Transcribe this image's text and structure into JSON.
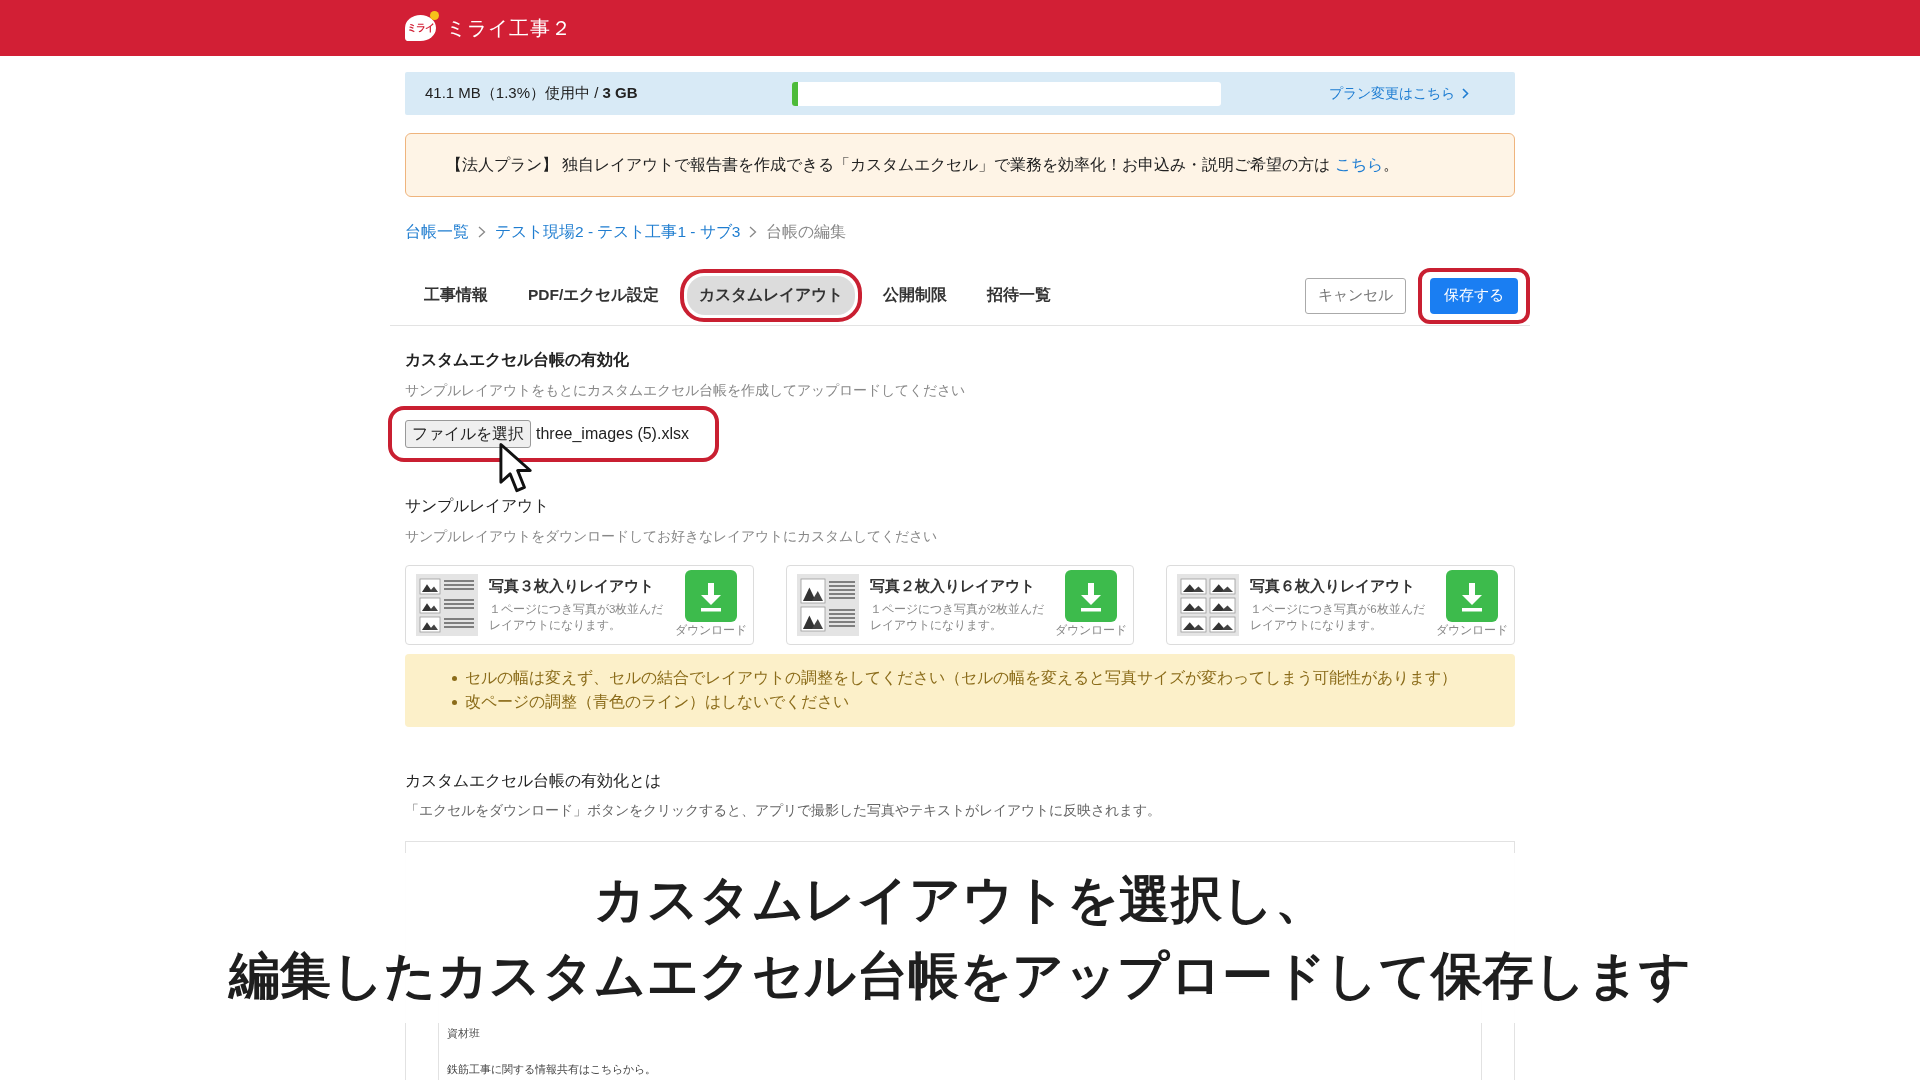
{
  "header": {
    "logo_text": "ミライ",
    "title": "ミライ工事２"
  },
  "storage": {
    "usage": "41.1 MB（1.3%）使用中 / **3 GB**",
    "level": 0.013,
    "link": "プラン変更はこちら"
  },
  "notice": {
    "text": "【法人プラン】 独自レイアウトで報告書を作成できる「カスタムエクセル」で業務を効率化！お申込み・説明ご希望の方は",
    "link": "こちら",
    "suffix": "。"
  },
  "breadcrumb": [
    {
      "label": "台帳一覧",
      "kind": "link"
    },
    {
      "label": "テスト現場2 - テスト工事1 - サブ3",
      "kind": "link"
    },
    {
      "label": "台帳の編集",
      "kind": "current"
    }
  ],
  "tabs": [
    {
      "label": "工事情報",
      "selected": false,
      "highlighted": false
    },
    {
      "label": "PDF/エクセル設定",
      "selected": false,
      "highlighted": false
    },
    {
      "label": "カスタムレイアウト",
      "selected": true,
      "highlighted": true
    },
    {
      "label": "公開制限",
      "selected": false,
      "highlighted": false
    },
    {
      "label": "招待一覧",
      "selected": false,
      "highlighted": false
    }
  ],
  "actions": [
    {
      "label": "キャンセル",
      "kind": "secondary",
      "highlighted": false
    },
    {
      "label": "保存する",
      "kind": "primary",
      "highlighted": true
    }
  ],
  "enable_section": {
    "title": "カスタムエクセル台帳の有効化",
    "description": "サンプルレイアウトをもとにカスタムエクセル台帳を作成してアップロードしてください",
    "file_input": {
      "button_label": "ファイルを選択",
      "filename": "three_images (5).xlsx",
      "highlighted": true
    }
  },
  "sample_section": {
    "title": "サンプルレイアウト",
    "description": "サンプルレイアウトをダウンロードしてお好きなレイアウトにカスタムしてください",
    "cards": [
      {
        "kind": "three",
        "title": "写真３枚入りレイアウト",
        "description": "１ページにつき写真が3枚並んだレイアウトになります。",
        "download_label": "ダウンロード"
      },
      {
        "kind": "two",
        "title": "写真２枚入りレイアウト",
        "description": "１ページにつき写真が2枚並んだレイアウトになります。",
        "download_label": "ダウンロード"
      },
      {
        "kind": "six",
        "title": "写真６枚入りレイアウト",
        "description": "１ページにつき写真が6枚並んだレイアウトになります。",
        "download_label": "ダウンロード"
      }
    ],
    "tips": [
      "セルの幅は変えず、セルの結合でレイアウトの調整をしてください（セルの幅を変えると写真サイズが変わってしまう可能性があります）",
      "改ページの調整（青色のライン）はしないでください"
    ]
  },
  "about_section": {
    "title": "カスタムエクセル台帳の有効化とは",
    "description": "「エクセルをダウンロード」ボタンをクリックすると、アプリで撮影した写真やテキストがレイアウトに反映されます。",
    "preview_texts": [
      "資材班",
      "鉄筋工事に関する情報共有はこちらから。"
    ]
  },
  "caption": [
    "カスタムレイアウトを選択し、",
    "編集したカスタムエクセル台帳をアップロードして保存します"
  ]
}
